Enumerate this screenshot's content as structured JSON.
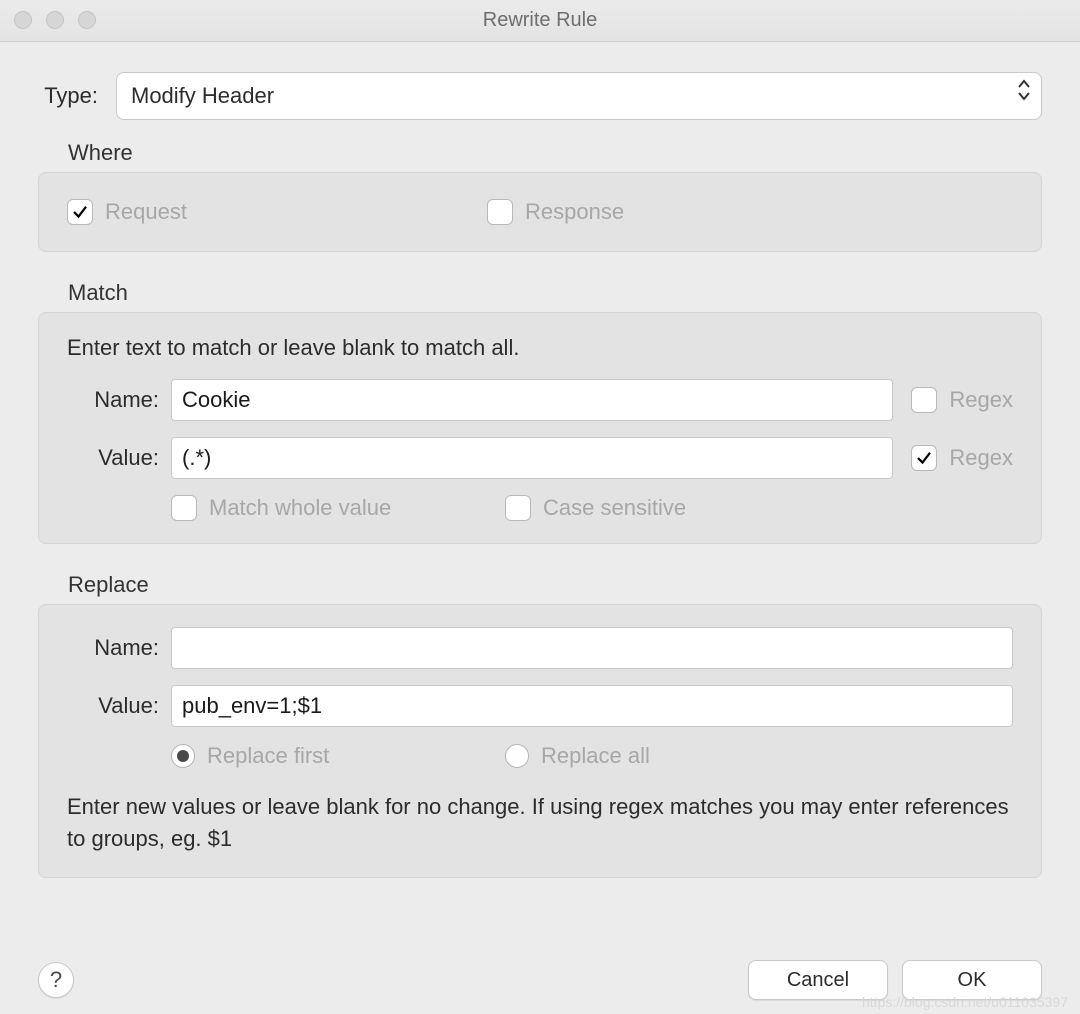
{
  "window": {
    "title": "Rewrite Rule"
  },
  "type": {
    "label": "Type:",
    "value": "Modify Header"
  },
  "where": {
    "section": "Where",
    "request": {
      "label": "Request",
      "checked": true
    },
    "response": {
      "label": "Response",
      "checked": false
    }
  },
  "match": {
    "section": "Match",
    "instruction": "Enter text to match or leave blank to match all.",
    "name": {
      "label": "Name:",
      "value": "Cookie",
      "regex_label": "Regex",
      "regex_checked": false
    },
    "value": {
      "label": "Value:",
      "value": "(.*)",
      "regex_label": "Regex",
      "regex_checked": true
    },
    "whole": {
      "label": "Match whole value",
      "checked": false
    },
    "casesens": {
      "label": "Case sensitive",
      "checked": false
    }
  },
  "replace": {
    "section": "Replace",
    "name": {
      "label": "Name:",
      "value": ""
    },
    "value": {
      "label": "Value:",
      "value": "pub_env=1;$1"
    },
    "first": {
      "label": "Replace first",
      "selected": true
    },
    "all": {
      "label": "Replace all",
      "selected": false
    },
    "instruction": "Enter new values or leave blank for no change. If using regex matches you may enter references to groups, eg. $1"
  },
  "footer": {
    "help": "?",
    "cancel": "Cancel",
    "ok": "OK"
  },
  "watermark": "https://blog.csdn.net/u011035397"
}
